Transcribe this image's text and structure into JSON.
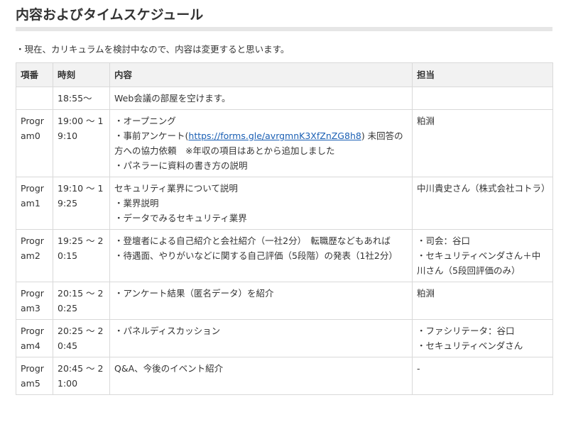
{
  "heading": "内容およびタイムスケジュール",
  "note": "・現在、カリキュラムを検討中なので、内容は変更すると思います。",
  "table": {
    "headers": [
      "項番",
      "時刻",
      "内容",
      "担当"
    ],
    "rows": [
      {
        "item": "",
        "time": "18:55～",
        "content": [
          "Web会議の部屋を空けます。"
        ],
        "person": [
          ""
        ]
      },
      {
        "item": "Program0",
        "time": "19:00 ～ 19:10",
        "content_line1": "・オープニング",
        "content_pre": "・事前アンケート(",
        "content_link": "https://forms.gle/avrgmnK3XfZnZG8h8",
        "content_post": ") 未回答の方への協力依頼　※年収の項目はあとから追加しました",
        "content_line3": "・パネラーに資料の書き方の説明",
        "person": [
          "粕淵"
        ]
      },
      {
        "item": "Program1",
        "time": "19:10 ～ 19:25",
        "content": [
          "セキュリティ業界について説明",
          "・業界説明",
          "・データでみるセキュリティ業界"
        ],
        "person": [
          "中川貴史さん（株式会社コトラ）"
        ]
      },
      {
        "item": "Program2",
        "time": "19:25 ～ 20:15",
        "content": [
          "・登壇者による自己紹介と会社紹介（一社2分）　転職歴などもあれば",
          "・待遇面、やりがいなどに関する自己評価（5段階）の発表（1社2分）"
        ],
        "person": [
          "・司会：谷口",
          "・セキュリティベンダさん＋中川さん（5段回評価のみ）"
        ]
      },
      {
        "item": "Program3",
        "time": "20:15 ～ 20:25",
        "content": [
          "・アンケート結果（匿名データ）を紹介"
        ],
        "person": [
          "粕淵"
        ]
      },
      {
        "item": "Program4",
        "time": "20:25 ～ 20:45",
        "content": [
          "・パネルディスカッション"
        ],
        "person": [
          "・ファシリテータ：谷口",
          "・セキュリティベンダさん"
        ]
      },
      {
        "item": "Program5",
        "time": "20:45 ～ 21:00",
        "content": [
          "Q&A、今後のイベント紹介"
        ],
        "person": [
          "-"
        ]
      }
    ]
  }
}
